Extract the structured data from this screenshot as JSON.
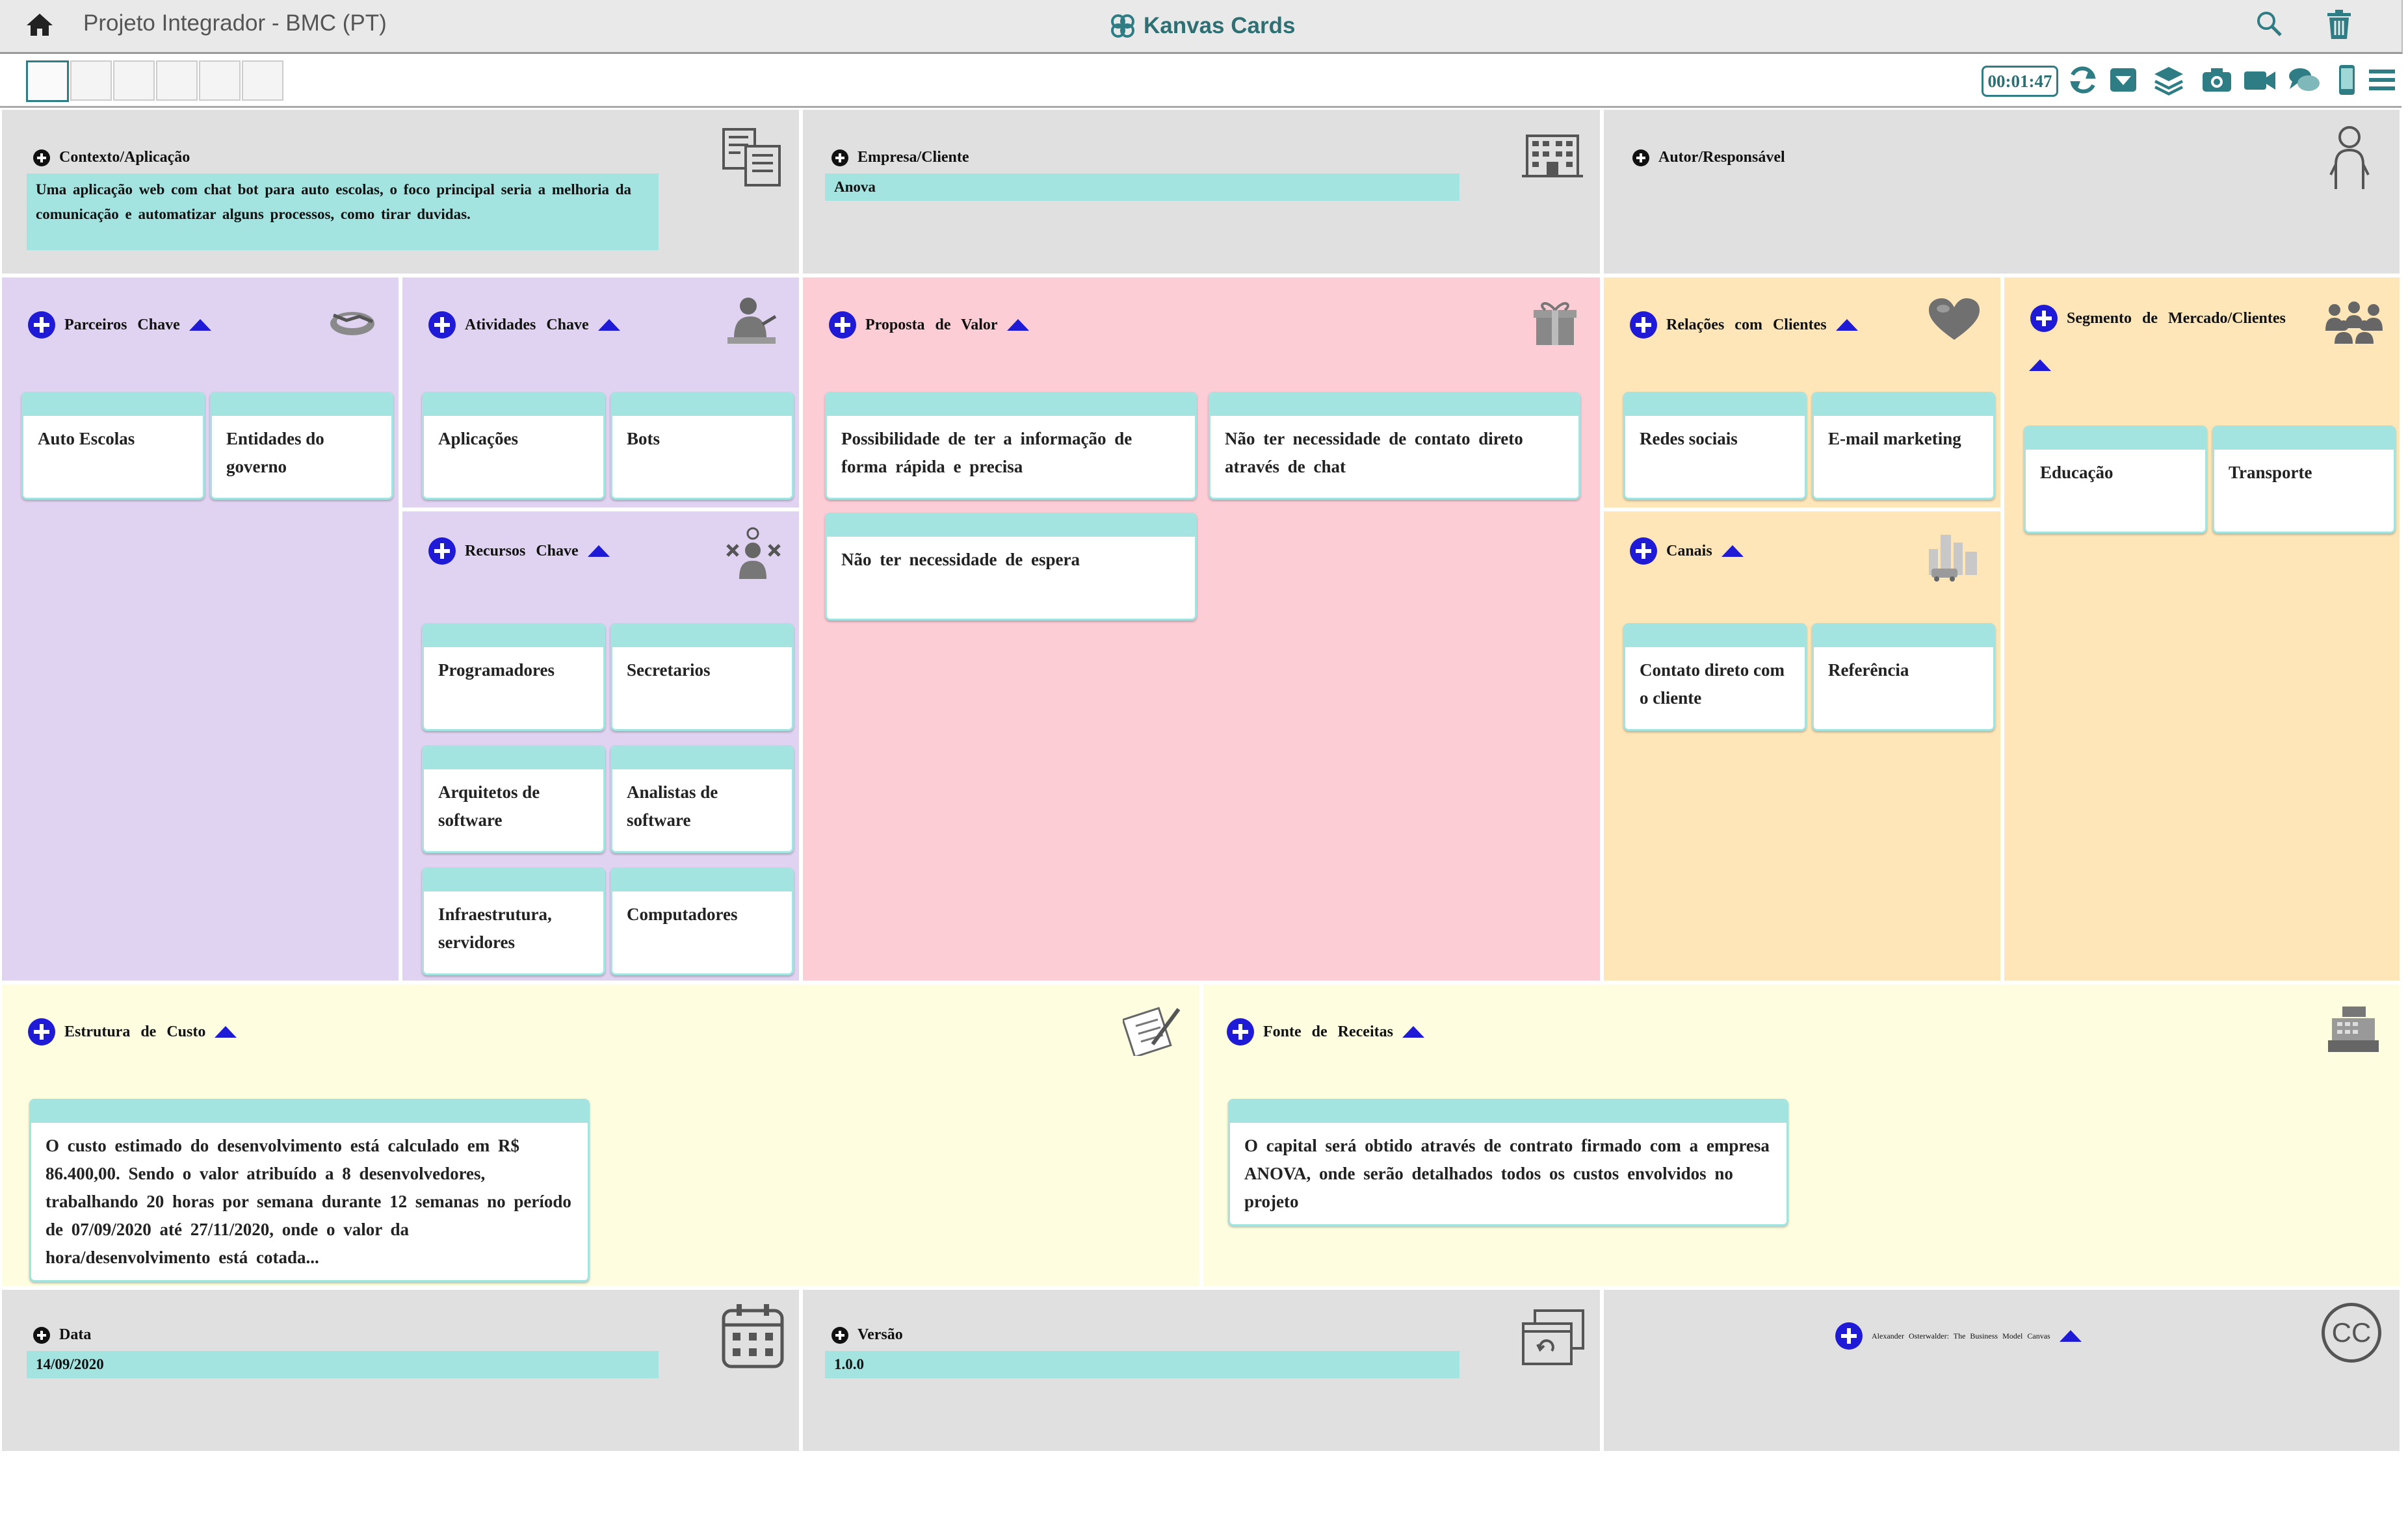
{
  "app": {
    "title": "Projeto Integrador - BMC (PT)",
    "brand": "Kanvas Cards",
    "timer": "00:01:47",
    "accent": "#2e7d84"
  },
  "colors": {
    "card_strip": "#a3e3e0",
    "grey": "#e0e0e0",
    "purple": "#e0d3f1",
    "pink": "#fdcdd6",
    "orange": "#fee6b8",
    "yellow": "#fefde0",
    "plus_blue": "#1f1ad6"
  },
  "toolbar_icons": [
    "refresh-icon",
    "dropdown-icon",
    "layers-icon",
    "camera-icon",
    "video-icon",
    "chat-icon",
    "mobile-icon",
    "menu-icon"
  ],
  "context": {
    "label": "Contexto/Aplicação",
    "value": "Uma aplicação web com chat bot para auto escolas, o foco principal seria a melhoria da comunicação e automatizar alguns processos, como tirar duvidas."
  },
  "company": {
    "label": "Empresa/Cliente",
    "value": "Anova"
  },
  "author": {
    "label": "Autor/Responsável"
  },
  "partners": {
    "label": "Parceiros Chave",
    "cards": [
      "Auto Escolas",
      "Entidades do governo"
    ]
  },
  "activities": {
    "label": "Atividades Chave",
    "cards": [
      "Aplicações",
      "Bots"
    ]
  },
  "resources": {
    "label": "Recursos Chave",
    "cards": [
      "Programadores",
      "Secretarios",
      "Arquitetos de software",
      "Analistas de software",
      "Infraestrutura, servidores",
      "Computadores"
    ]
  },
  "value_prop": {
    "label": "Proposta de Valor",
    "cards": [
      "Possibilidade de ter a informação de forma rápida e precisa",
      "Não ter necessidade de contato direto através de chat",
      "Não ter necessidade de espera"
    ]
  },
  "relations": {
    "label": "Relações com Clientes",
    "cards": [
      "Redes sociais",
      "E-mail marketing"
    ]
  },
  "channels": {
    "label": "Canais",
    "cards": [
      "Contato direto com o cliente",
      "Referência"
    ]
  },
  "segments": {
    "label": "Segmento de Mercado/Clientes",
    "cards": [
      "Educação",
      "Transporte"
    ]
  },
  "costs": {
    "label": "Estrutura de Custo",
    "cards": [
      "O custo estimado do desenvolvimento está calculado em R$ 86.400,00. Sendo o valor atribuído a 8 desenvolvedores, trabalhando 20 horas por semana durante 12 semanas no período de 07/09/2020 até 27/11/2020, onde o valor da hora/desenvolvimento está cotada..."
    ]
  },
  "revenue": {
    "label": "Fonte de Receitas",
    "cards": [
      "O capital será obtido através de contrato firmado com a empresa ANOVA, onde serão detalhados todos os custos envolvidos no projeto"
    ]
  },
  "date": {
    "label": "Data",
    "value": "14/09/2020"
  },
  "version": {
    "label": "Versão",
    "value": "1.0.0"
  },
  "credit": {
    "label": "Alexander Osterwalder: The Business Model Canvas",
    "license": "CC"
  }
}
